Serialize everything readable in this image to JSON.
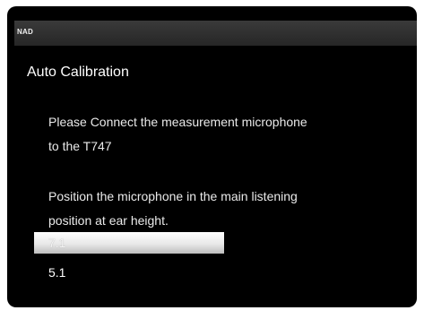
{
  "brand": "NAD",
  "title": "Auto Calibration",
  "message": {
    "line1": "Please Connect the measurement microphone",
    "line2": "to the T747",
    "line3": "Position the microphone in the main listening",
    "line4": "position at ear height."
  },
  "options": [
    {
      "label": "7.1",
      "selected": true
    },
    {
      "label": "5.1",
      "selected": false
    }
  ],
  "colors": {
    "background": "#000000",
    "topbar": "#2f2f2f",
    "highlight": "#e8e8e8",
    "text": "#ffffff"
  }
}
